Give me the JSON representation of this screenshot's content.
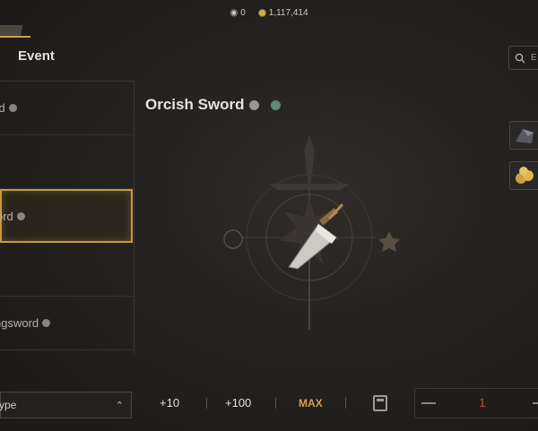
{
  "topbar": {
    "eye_count": "0",
    "gold_amount": "1,117,414"
  },
  "tabs": {
    "event_label": "Event"
  },
  "search": {
    "label": "E",
    "icon": "search-icon"
  },
  "item_list": {
    "items": [
      {
        "label": "rd"
      },
      {
        "label": ""
      },
      {
        "label": "ord"
      },
      {
        "label": ""
      },
      {
        "label": "ngsword"
      }
    ],
    "selected_index": 2
  },
  "detail": {
    "title": "Orcish Sword"
  },
  "bottom": {
    "type_label": "ype",
    "plus10": "+10",
    "plus100": "+100",
    "max": "MAX",
    "quantity": "1"
  },
  "colors": {
    "accent": "#c59a40",
    "gold": "#d2a04a",
    "qty_red": "#c2473d"
  }
}
